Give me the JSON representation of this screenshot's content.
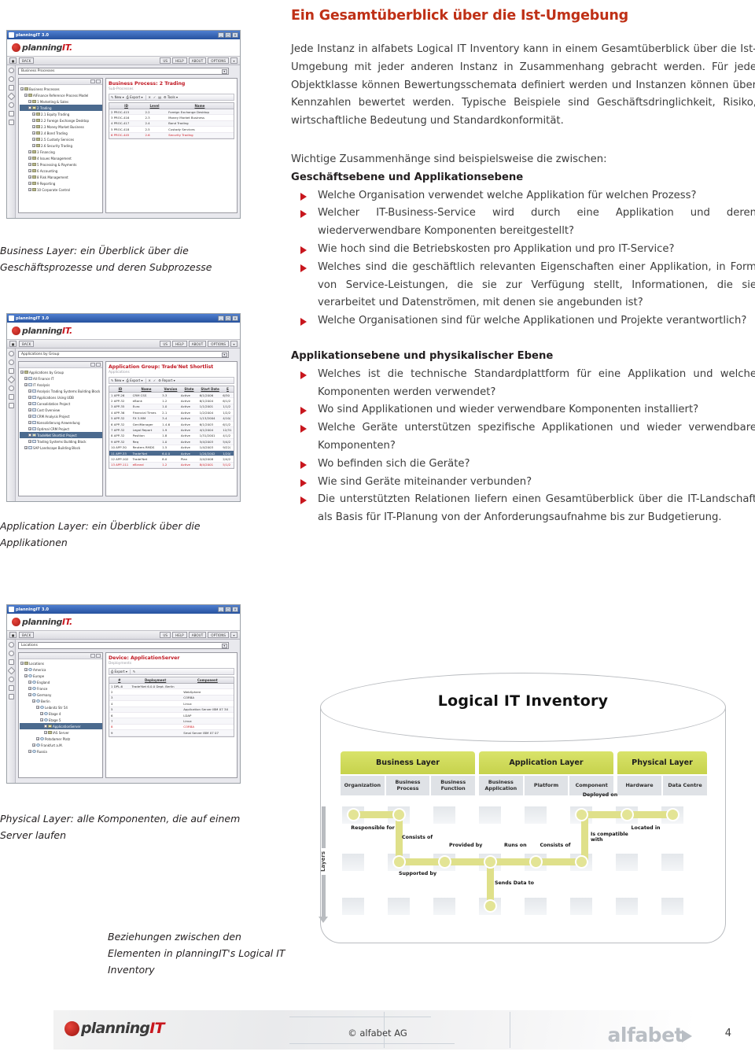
{
  "page": {
    "title": "Ein Gesamtüberblick über die Ist-Umgebung",
    "intro": "Jede Instanz in alfabets Logical IT Inventory kann in einem Gesamtüberblick über die Ist-Umgebung mit jeder anderen Instanz in Zusammenhang gebracht werden. Für jede Objektklasse können Bewertungsschemata definiert werden und  Instanzen können über Kennzahlen bewertet werden. Typische Beispiele sind Geschäftsdringlichkeit, Risiko, wirtschaftliche Bedeutung und Standardkonformität.",
    "page_number": "4"
  },
  "sections": [
    {
      "lead": "Wichtige Zusammenhänge sind beispielsweise die zwischen:",
      "subhead": "Geschäftsebene und Applikationsebene",
      "bullets": [
        "Welche Organisation verwendet welche Applikation für welchen Prozess?",
        "Welcher IT-Business-Service wird durch eine Applikation und deren wiederverwendbare Komponenten bereitgestellt?",
        "Wie hoch sind die Betriebskosten pro Applikation und pro IT-Service?",
        "Welches sind die geschäftlich relevanten Eigenschaften einer Applikation, in Form von Service-Leistungen, die sie zur Verfügung stellt, Informationen, die sie verarbeitet und Datenströmen, mit denen sie angebunden ist?",
        "Welche Organisationen sind für welche Applikationen und Projekte verantwortlich?"
      ]
    },
    {
      "lead": "",
      "subhead": "Applikationsebene und physikalischer Ebene",
      "bullets": [
        "Welches ist die technische Standardplattform für eine Applikation und welche Komponenten werden verwendet?",
        "Wo sind Applikationen und wieder verwendbare Komponenten installiert?",
        "Welche Geräte unterstützen spezifische Applikationen und wieder verwendbare Komponenten?",
        "Wo befinden sich die Geräte?",
        "Wie sind Geräte miteinander verbunden?",
        "Die unterstützten Relationen liefern einen Gesamtüberblick über die IT-Landschaft als Basis für IT-Planung von der Anforderungsaufnahme bis zur Budgetierung."
      ]
    }
  ],
  "captions": {
    "business_layer": "Business Layer: ein Überblick über die Geschäftsprozesse und deren Subprozesse",
    "application_layer": "Application Layer: ein Überblick über die Applikationen",
    "physical_layer": "Physical Layer: alle Komponenten, die auf einem Server laufen",
    "relations": "Beziehungen zwischen den Elementen in planningIT's Logical IT Inventory"
  },
  "screenshots": [
    {
      "window_title": "planningIT 3.0",
      "brand": {
        "part1": "planning",
        "part2": "IT."
      },
      "nav": {
        "back": "BACK",
        "buttons": [
          "US",
          "HELP",
          "ABOUT",
          "OPTIONS"
        ]
      },
      "selector": "Business Processes",
      "tree": [
        {
          "label": "Business Processes",
          "indent": 0,
          "icon": "root",
          "selected": false
        },
        {
          "label": "AlFinance Reference Process Model",
          "indent": 1,
          "icon": "model",
          "selected": false
        },
        {
          "label": "1 Marketing & Sales",
          "indent": 2,
          "icon": "proc",
          "selected": false
        },
        {
          "label": "2 Trading",
          "indent": 2,
          "icon": "proc",
          "selected": true
        },
        {
          "label": "2.1 Equity Trading",
          "indent": 3,
          "icon": "proc",
          "selected": false
        },
        {
          "label": "2.2 Foreign Exchange Desktop",
          "indent": 3,
          "icon": "proc",
          "selected": false
        },
        {
          "label": "2.3 Money Market Business",
          "indent": 3,
          "icon": "proc",
          "selected": false
        },
        {
          "label": "2.4 Bond Trading",
          "indent": 3,
          "icon": "proc",
          "selected": false
        },
        {
          "label": "2.5 Custody Services",
          "indent": 3,
          "icon": "proc",
          "selected": false
        },
        {
          "label": "2.6 Security Trading",
          "indent": 3,
          "icon": "proc",
          "selected": false
        },
        {
          "label": "3 Financing",
          "indent": 2,
          "icon": "proc",
          "selected": false
        },
        {
          "label": "4 Issues Management",
          "indent": 2,
          "icon": "proc",
          "selected": false
        },
        {
          "label": "5 Processing & Payments",
          "indent": 2,
          "icon": "proc",
          "selected": false
        },
        {
          "label": "6 Accounting",
          "indent": 2,
          "icon": "proc",
          "selected": false
        },
        {
          "label": "8 Risk Management",
          "indent": 2,
          "icon": "proc",
          "selected": false
        },
        {
          "label": "9 Reporting",
          "indent": 2,
          "icon": "proc",
          "selected": false
        },
        {
          "label": "10 Corporate Control",
          "indent": 2,
          "icon": "proc",
          "selected": false
        }
      ],
      "detail": {
        "title": "Business Process: 2 Trading",
        "subtitle": "Sub-Processes",
        "tools": [
          "New",
          "Export",
          "Tools"
        ],
        "columns": [
          "ID",
          "Level",
          "Name"
        ],
        "rows": [
          {
            "cells": [
              "2 PROC-415",
              "2.2",
              "Foreign Exchange Desktop"
            ],
            "red": false
          },
          {
            "cells": [
              "3 PROC-416",
              "2.3",
              "Money Market Business"
            ],
            "red": false
          },
          {
            "cells": [
              "4 PROC-417",
              "2.4",
              "Bond Trading"
            ],
            "red": false
          },
          {
            "cells": [
              "5 PROC-418",
              "2.5",
              "Custody Services"
            ],
            "red": false
          },
          {
            "cells": [
              "6 PROC-445",
              "2.6",
              "Security Trading"
            ],
            "red": true
          }
        ]
      }
    },
    {
      "window_title": "planningIT 3.0",
      "brand": {
        "part1": "planning",
        "part2": "IT."
      },
      "nav": {
        "back": "BACK",
        "buttons": [
          "US",
          "HELP",
          "ABOUT",
          "OPTIONS"
        ]
      },
      "selector": "Applications by Group",
      "tree": [
        {
          "label": "Applications by Group",
          "indent": 0,
          "icon": "root",
          "selected": false
        },
        {
          "label": "All Finance IT",
          "indent": 1,
          "icon": "folder",
          "selected": false
        },
        {
          "label": "IT Analysis",
          "indent": 1,
          "icon": "folder",
          "selected": false
        },
        {
          "label": "Analysis Trading Systems Building Block",
          "indent": 2,
          "icon": "folder",
          "selected": false
        },
        {
          "label": "Applications Using UDB",
          "indent": 2,
          "icon": "folder",
          "selected": false
        },
        {
          "label": "Consolidation Project",
          "indent": 2,
          "icon": "folder",
          "selected": false
        },
        {
          "label": "Cost Overview",
          "indent": 2,
          "icon": "folder",
          "selected": false
        },
        {
          "label": "CRM Analysis Project",
          "indent": 2,
          "icon": "folder",
          "selected": false
        },
        {
          "label": "Konsolidierung Anwendung",
          "indent": 2,
          "icon": "folder",
          "selected": false
        },
        {
          "label": "Optimal CRM Project",
          "indent": 2,
          "icon": "folder",
          "selected": false
        },
        {
          "label": "TradeNet Shortlist Project",
          "indent": 2,
          "icon": "folder",
          "selected": true
        },
        {
          "label": "Trading Systems Building Block",
          "indent": 2,
          "icon": "folder",
          "selected": false
        },
        {
          "label": "SAP Landscape Building Block",
          "indent": 1,
          "icon": "folder",
          "selected": false
        }
      ],
      "detail": {
        "title": "Application Group: Trade'Net Shortlist",
        "subtitle": "Applications",
        "tools": [
          "New",
          "Export",
          "Report"
        ],
        "columns": [
          "ID",
          "Name",
          "Version",
          "State",
          "Start Date",
          "E"
        ],
        "rows": [
          {
            "cells": [
              "1 APP-26",
              "CRM CSS",
              "3.3",
              "Active",
              "6/1/2006",
              "6/30"
            ],
            "red": false
          },
          {
            "cells": [
              "2 APP-32",
              "eBank",
              "1.2",
              "Active",
              "6/1/2004",
              "6/1/2"
            ],
            "red": false
          },
          {
            "cells": [
              "3 APP-35",
              "Euro",
              "1.0",
              "Active",
              "1/1/2001",
              "1/1/2"
            ],
            "red": false
          },
          {
            "cells": [
              "4 APP-36",
              "Financial Times",
              "2.1",
              "Active",
              "1/2/2004",
              "1/2/2"
            ],
            "red": false
          },
          {
            "cells": [
              "5 APP-32",
              "FX 3.MM",
              "3.4",
              "Active",
              "1/13/2004",
              "4/10/"
            ],
            "red": false
          },
          {
            "cells": [
              "6 APP-32",
              "GeniManager",
              "1.4.6",
              "Active",
              "6/1/2003",
              "6/1/2"
            ],
            "red": false
          },
          {
            "cells": [
              "7 APP-32",
              "Legal Report",
              "1.9",
              "Active",
              "4/1/2004",
              "12/31"
            ],
            "red": false
          },
          {
            "cells": [
              "8 APP-32",
              "Position",
              "1.8",
              "Active",
              "1/31/2001",
              "4/1/2"
            ],
            "red": false
          },
          {
            "cells": [
              "9 APP-32",
              "Req",
              "1.0",
              "Active",
              "5/4/2003",
              "5/4/2"
            ],
            "red": false
          },
          {
            "cells": [
              "10 APP-30",
              "Reuters RMDS",
              "1.5",
              "Active",
              "1/4/2003",
              "9/22/"
            ],
            "red": false
          },
          {
            "cells": [
              "11 APP-33",
              "Trade'Net",
              "6.0.0",
              "Active",
              "1/20/2002",
              "1/20/"
            ],
            "red": false,
            "selected": true
          },
          {
            "cells": [
              "12 APP-102",
              "Trade'Net",
              "8.0",
              "Plan",
              "2/4/2008",
              "2/4/2"
            ],
            "red": false
          },
          {
            "cells": [
              "13 APP-111",
              "eBrand",
              "1.2",
              "Active",
              "8/4/2001",
              "5/1/2"
            ],
            "red": true
          }
        ]
      }
    },
    {
      "window_title": "planningIT 3.0",
      "brand": {
        "part1": "planning",
        "part2": "IT."
      },
      "nav": {
        "back": "BACK",
        "buttons": [
          "US",
          "HELP",
          "ABOUT",
          "OPTIONS"
        ]
      },
      "selector": "Locations",
      "tree": [
        {
          "label": "Locations",
          "indent": 0,
          "icon": "root",
          "selected": false
        },
        {
          "label": "America",
          "indent": 1,
          "icon": "globe",
          "selected": false
        },
        {
          "label": "Europe",
          "indent": 1,
          "icon": "globe",
          "selected": false
        },
        {
          "label": "England",
          "indent": 2,
          "icon": "globe",
          "selected": false
        },
        {
          "label": "France",
          "indent": 2,
          "icon": "globe",
          "selected": false
        },
        {
          "label": "Germany",
          "indent": 2,
          "icon": "globe",
          "selected": false
        },
        {
          "label": "Berlin",
          "indent": 3,
          "icon": "globe",
          "selected": false
        },
        {
          "label": "Leibnitz Str 54",
          "indent": 4,
          "icon": "globe",
          "selected": false
        },
        {
          "label": "Etage 4",
          "indent": 5,
          "icon": "globe",
          "selected": false
        },
        {
          "label": "Etage 5",
          "indent": 5,
          "icon": "globe",
          "selected": false
        },
        {
          "label": "ApplicationServer",
          "indent": 6,
          "icon": "device",
          "selected": true
        },
        {
          "label": "IAS Server",
          "indent": 6,
          "icon": "device",
          "selected": false
        },
        {
          "label": "Potsdamer Platz",
          "indent": 4,
          "icon": "globe",
          "selected": false
        },
        {
          "label": "Frankfurt a.M.",
          "indent": 3,
          "icon": "globe",
          "selected": false
        },
        {
          "label": "Russia",
          "indent": 2,
          "icon": "globe",
          "selected": false
        }
      ],
      "detail": {
        "title": "Device: ApplicationServer",
        "subtitle": "Deployments",
        "tools": [
          "Export"
        ],
        "columns": [
          "#",
          "Deployment",
          "Component"
        ],
        "rows": [
          {
            "cells": [
              "1 DPL-6",
              "Trade'Net 6.0.0 Dept. Berlin",
              ""
            ],
            "red": false
          },
          {
            "cells": [
              "2",
              "",
              "WebSphere"
            ],
            "red": false
          },
          {
            "cells": [
              "3",
              "",
              "CORBA"
            ],
            "red": false
          },
          {
            "cells": [
              "4",
              "",
              "Linux"
            ],
            "red": false
          },
          {
            "cells": [
              "5",
              "",
              "Application Server IBM X7 3X"
            ],
            "red": false
          },
          {
            "cells": [
              "6",
              "",
              "LDAP"
            ],
            "red": false
          },
          {
            "cells": [
              "7",
              "",
              "Linux"
            ],
            "red": false
          },
          {
            "cells": [
              "8",
              "",
              "CORBA"
            ],
            "red": true
          },
          {
            "cells": [
              "9",
              "",
              "Smal Server IBM X7 07"
            ],
            "red": false
          }
        ]
      }
    }
  ],
  "diagram": {
    "title": "Logical IT Inventory",
    "layers": [
      "Business Layer",
      "Application Layer",
      "Physical Layer"
    ],
    "classes_business": [
      "Organization",
      "Business Process",
      "Business Function"
    ],
    "classes_application": [
      "Business Application",
      "Platform",
      "Component"
    ],
    "classes_physical": [
      "Hardware",
      "Data Centre"
    ],
    "axis_label": "Layers",
    "relations": [
      "Responsible for",
      "Consists of",
      "Supported by",
      "Provided by",
      "Runs on",
      "Consists of",
      "Sends Data to",
      "Deployed on",
      "Is compatible with",
      "Located in"
    ]
  },
  "footer": {
    "brand": {
      "part1": "planning",
      "part2": "IT"
    },
    "copyright": "© alfabet AG",
    "company": "alfabet",
    "page": "4"
  }
}
